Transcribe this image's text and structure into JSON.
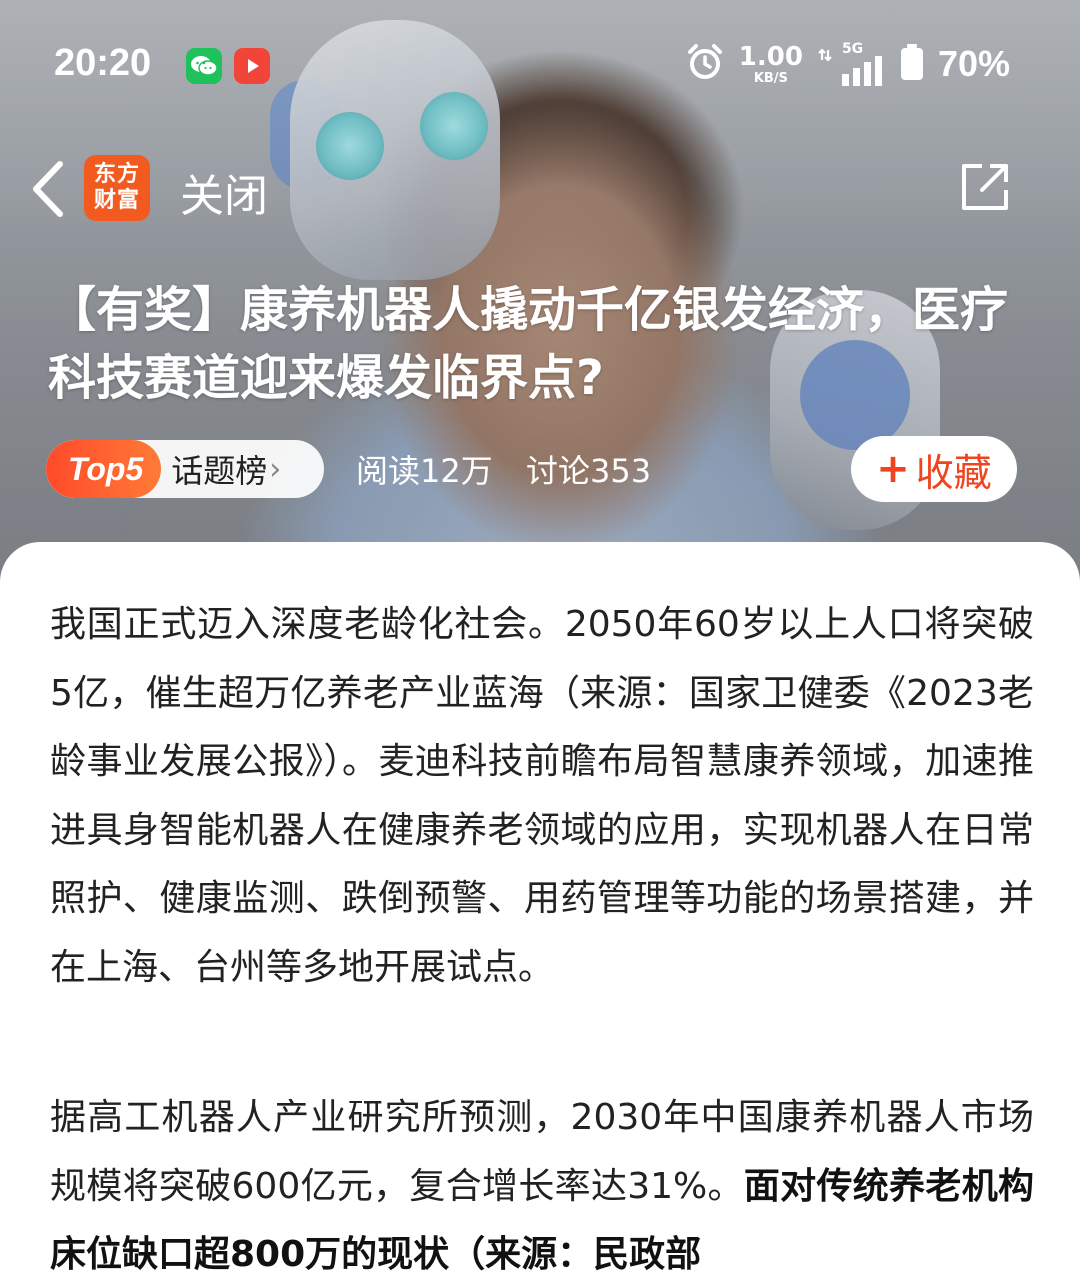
{
  "status_bar": {
    "time": "20:20",
    "net_speed": "1.00",
    "net_speed_unit": "KB/S",
    "network": "5G",
    "battery": "70%"
  },
  "nav": {
    "logo_line1": "东方",
    "logo_line2": "财富",
    "close_label": "关闭"
  },
  "article": {
    "title": "【有奖】康养机器人撬动千亿银发经济，医疗科技赛道迎来爆发临界点?",
    "topic_rank": "Top5",
    "topic_label": "话题榜",
    "reads": "阅读12万",
    "discussions": "讨论353",
    "favorite_label": "收藏",
    "paragraph1": "我国正式迈入深度老龄化社会。2050年60岁以上人口将突破5亿，催生超万亿养老产业蓝海（来源：国家卫健委《2023老龄事业发展公报》）。麦迪科技前瞻布局智慧康养领域，加速推进具身智能机器人在健康养老领域的应用，实现机器人在日常照护、健康监测、跌倒预警、用药管理等功能的场景搭建，并在上海、台州等多地开展试点。",
    "paragraph2_normal": "据高工机器人产业研究所预测，2030年中国康养机器人市场规模将突破600亿元，复合增长率达31%。",
    "paragraph2_bold": "面对传统养老机构床位缺口超800万的现状（来源：民政部"
  },
  "colors": {
    "brand_orange": "#f25a1f",
    "favorite_red": "#f0441f",
    "text_dark": "#222222"
  }
}
